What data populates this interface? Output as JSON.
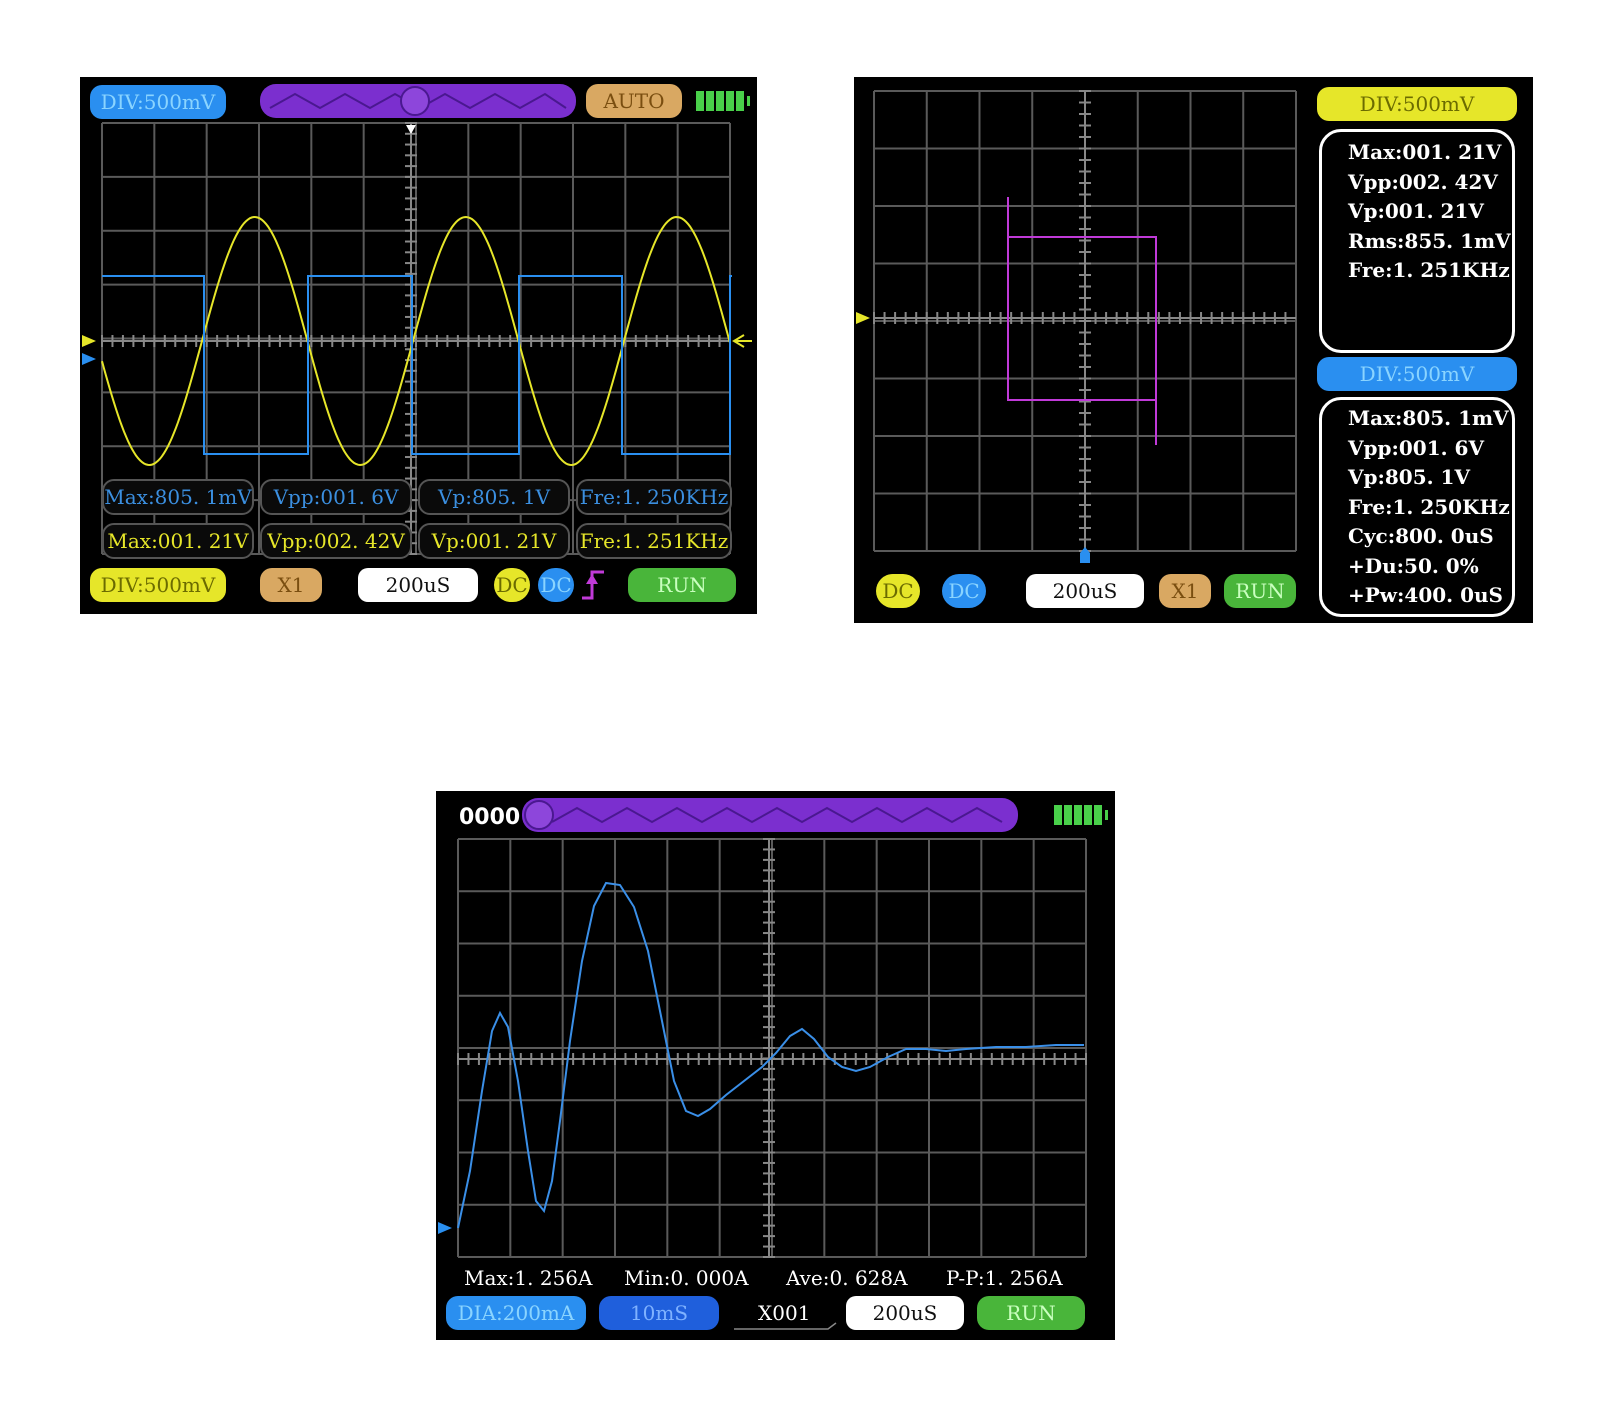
{
  "screen1": {
    "ch2_div": "DIV:500mV",
    "trigger_mode": "AUTO",
    "ch1_div": "DIV:500mV",
    "probe": "X1",
    "timebase": "200uS",
    "ch1_coupling": "DC",
    "ch2_coupling": "DC",
    "run_state": "RUN",
    "battery_icon": "battery-full-icon",
    "trigger_edge_icon": "rising-edge-icon",
    "ch2_measurements": [
      "Max:805. 1mV",
      "Vpp:001. 6V",
      "Vp:805. 1V",
      "Fre:1. 250KHz"
    ],
    "ch1_measurements": [
      "Max:001. 21V",
      "Vpp:002. 42V",
      "Vp:001. 21V",
      "Fre:1. 251KHz"
    ]
  },
  "screen2": {
    "ch1_div": "DIV:500mV",
    "ch1_info": [
      "Max:001. 21V",
      "Vpp:002. 42V",
      "Vp:001. 21V",
      "Rms:855. 1mV",
      "Fre:1. 251KHz"
    ],
    "ch2_div": "DIV:500mV",
    "ch2_info": [
      "Max:805. 1mV",
      "Vpp:001. 6V",
      "Vp:805. 1V",
      "Fre:1. 250KHz",
      "Cyc:800. 0uS",
      "+Du:50. 0%",
      "+Pw:400. 0uS"
    ],
    "ch1_coupling": "DC",
    "ch2_coupling": "DC",
    "timebase": "200uS",
    "probe": "X1",
    "run_state": "RUN"
  },
  "screen3": {
    "counter": "0000",
    "battery_icon": "battery-full-icon",
    "measurements": [
      "Max:1. 256A",
      "Min:0. 000A",
      "Ave:0. 628A",
      "P-P:1. 256A"
    ],
    "div": "DIA:200mA",
    "time_window": "10mS",
    "multiplier": "X001",
    "timebase": "200uS",
    "run_state": "RUN"
  },
  "colors": {
    "ch1_yellow": "#e6e629",
    "ch2_blue": "#2a8ff0",
    "xy_magenta": "#c03ad8",
    "run_green": "#49b53a",
    "slider_purple": "#7b2fcf",
    "grid": "#5a5a5a"
  }
}
